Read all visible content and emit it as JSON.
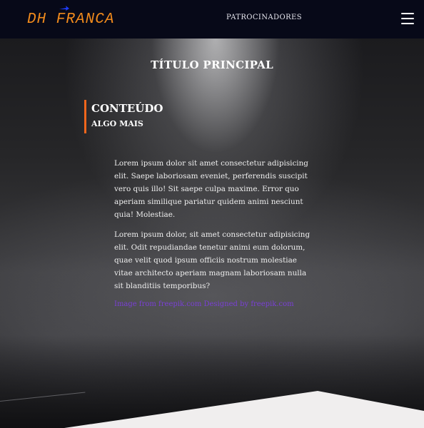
{
  "header": {
    "logo_text": "DH FRANCA",
    "nav_link": "PATROCINADORES",
    "menu_icon": "hamburger-menu-icon"
  },
  "main": {
    "title": "TÍTULO PRINCIPAL",
    "section": {
      "title": "CONTEÚDO",
      "subtitle": "ALGO MAIS"
    },
    "paragraphs": [
      "Lorem ipsum dolor sit amet consectetur adipisicing elit. Saepe laboriosam eveniet, perferendis suscipit vero quis illo! Sit saepe culpa maxime. Error quo aperiam similique pariatur quidem animi nesciunt quia! Molestiae.",
      "Lorem ipsum dolor, sit amet consectetur adipisicing elit. Odit repudiandae tenetur animi eum dolorum, quae velit quod ipsum officiis nostrum molestiae vitae architecto aperiam magnam laboriosam nulla sit blanditiis temporibus?"
    ],
    "credit_link": "Image from freepik.com  Designed by  freepik.com"
  },
  "colors": {
    "header_bg": "#070918",
    "logo_color": "#f08a1c",
    "logo_accent": "#1e3cff",
    "section_accent": "#f0661c",
    "link_color": "#7a3fd6",
    "footer_wedge": "#f0eeee"
  }
}
